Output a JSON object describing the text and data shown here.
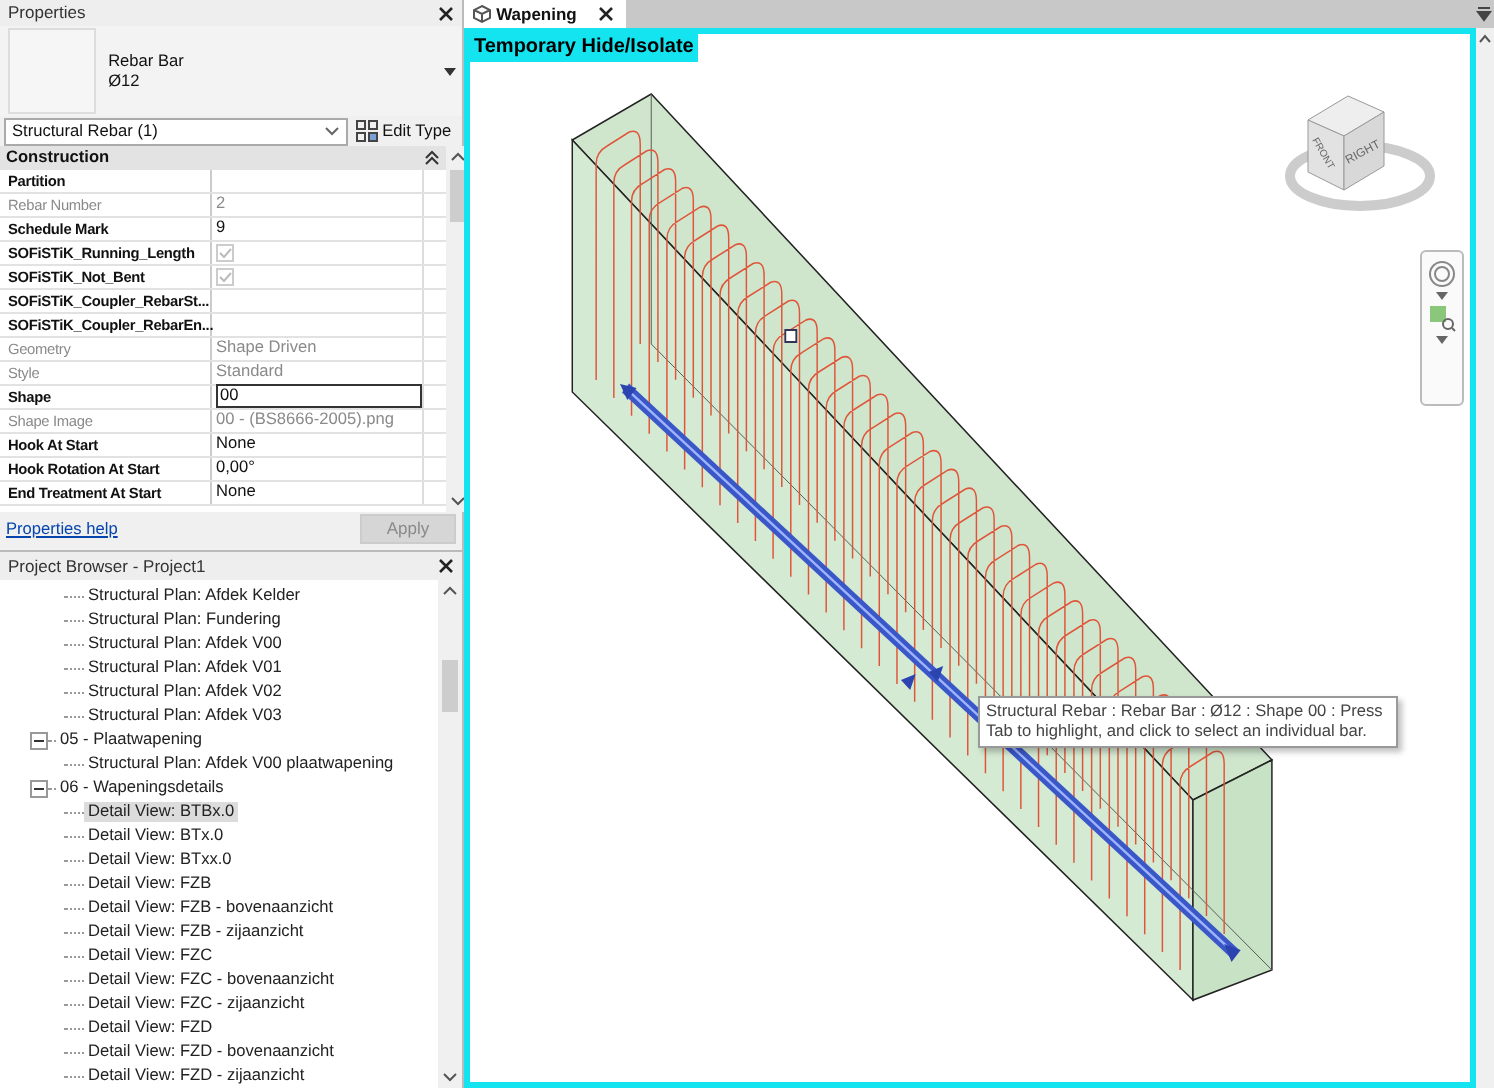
{
  "properties": {
    "title": "Properties",
    "type_name": "Rebar Bar",
    "type_size": "Ø12",
    "selector": "Structural Rebar (1)",
    "edit_type": "Edit Type",
    "group": {
      "label": "Construction",
      "expanded": true
    },
    "rows": [
      {
        "name": "Partition",
        "kind": "text",
        "disabled": false
      },
      {
        "name": "Rebar Number",
        "value": "2",
        "kind": "text",
        "disabled": true
      },
      {
        "name": "Schedule Mark",
        "value": "9",
        "kind": "text",
        "disabled": false
      },
      {
        "name": "SOFiSTiK_Running_Length",
        "kind": "checkbox",
        "checked": true,
        "disabled": false
      },
      {
        "name": "SOFiSTiK_Not_Bent",
        "kind": "checkbox",
        "checked": true,
        "disabled": false
      },
      {
        "name": "SOFiSTiK_Coupler_RebarSt...",
        "kind": "text",
        "disabled": false
      },
      {
        "name": "SOFiSTiK_Coupler_RebarEn...",
        "kind": "text",
        "disabled": false
      },
      {
        "name": "Geometry",
        "value": "Shape Driven",
        "kind": "text",
        "disabled": true
      },
      {
        "name": "Style",
        "value": "Standard",
        "kind": "text",
        "disabled": true
      },
      {
        "name": "Shape",
        "value": "00",
        "kind": "field",
        "disabled": false
      },
      {
        "name": "Shape Image",
        "value": "00 - (BS8666-2005).png",
        "kind": "text",
        "disabled": true
      },
      {
        "name": "Hook At Start",
        "value": "None",
        "kind": "text",
        "disabled": false
      },
      {
        "name": "Hook Rotation At Start",
        "value": "0,00°",
        "kind": "text",
        "disabled": false
      },
      {
        "name": "End Treatment At Start",
        "value": "None",
        "kind": "text",
        "disabled": false
      }
    ],
    "help_link": "Properties help",
    "apply": {
      "label": "Apply",
      "disabled": true
    }
  },
  "project_browser": {
    "title": "Project Browser - Project1",
    "tree": [
      {
        "children": [
          {
            "label": "Structural Plan: Afdek Kelder",
            "selected": false
          },
          {
            "label": "Structural Plan: Fundering",
            "selected": false
          },
          {
            "label": "Structural Plan: Afdek V00",
            "selected": false
          },
          {
            "label": "Structural Plan: Afdek V01",
            "selected": false
          },
          {
            "label": "Structural Plan: Afdek V02",
            "selected": false
          },
          {
            "label": "Structural Plan: Afdek V03",
            "selected": false
          }
        ]
      },
      {
        "label": "05 - Plaatwapening",
        "expanded": true,
        "children": [
          {
            "label": "Structural Plan: Afdek V00 plaatwapening",
            "selected": false
          }
        ]
      },
      {
        "label": "06 - Wapeningsdetails",
        "expanded": true,
        "children": [
          {
            "label": "Detail View: BTBx.0",
            "selected": true
          },
          {
            "label": "Detail View: BTx.0",
            "selected": false
          },
          {
            "label": "Detail View: BTxx.0",
            "selected": false
          },
          {
            "label": "Detail View: FZB",
            "selected": false
          },
          {
            "label": "Detail View: FZB - bovenaanzicht",
            "selected": false
          },
          {
            "label": "Detail View: FZB - zijaanzicht",
            "selected": false
          },
          {
            "label": "Detail View: FZC",
            "selected": false
          },
          {
            "label": "Detail View: FZC - bovenaanzicht",
            "selected": false
          },
          {
            "label": "Detail View: FZC - zijaanzicht",
            "selected": false
          },
          {
            "label": "Detail View: FZD",
            "selected": false
          },
          {
            "label": "Detail View: FZD - bovenaanzicht",
            "selected": false
          },
          {
            "label": "Detail View: FZD - zijaanzicht",
            "selected": false
          }
        ]
      }
    ]
  },
  "view": {
    "tabs": [
      {
        "label": "Wapening",
        "selected": true
      }
    ],
    "mode_label": "Temporary Hide/Isolate",
    "viewcube": {
      "faces": [
        "FRONT",
        "RIGHT"
      ]
    },
    "tooltip": "Structural Rebar : Rebar Bar : Ø12 : Shape 00 : Press Tab to highlight, and click to select an individual bar."
  }
}
